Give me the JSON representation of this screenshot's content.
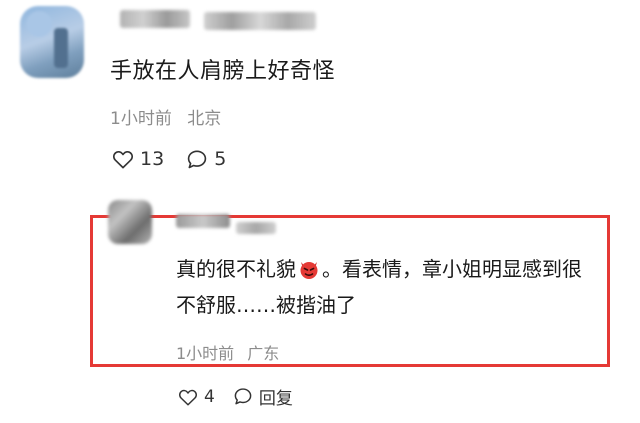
{
  "comment": {
    "text": "手放在人肩膀上好奇怪",
    "time": "1小时前",
    "location": "北京",
    "likes": "13",
    "replies": "5"
  },
  "reply": {
    "text_part1": "真的很不礼貌",
    "text_part2": "。看表情，章小姐明显感到很不舒服……被揩油了",
    "emoji_icon": "angry-devil-face-icon",
    "time": "1小时前",
    "location": "广东",
    "likes": "4",
    "reply_label": "回复"
  },
  "colors": {
    "highlight": "#e53935",
    "meta": "#8c8c8c"
  }
}
